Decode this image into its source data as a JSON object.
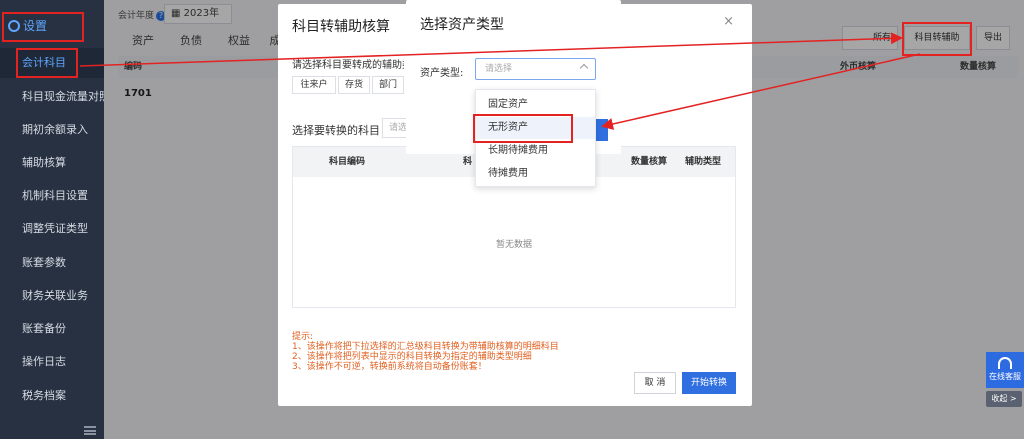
{
  "sidebar": {
    "settings_label": "设置",
    "items": [
      {
        "label": "会计科目"
      },
      {
        "label": "科目现金流量对照"
      },
      {
        "label": "期初余额录入"
      },
      {
        "label": "辅助核算"
      },
      {
        "label": "机制科目设置"
      },
      {
        "label": "调整凭证类型"
      },
      {
        "label": "账套参数"
      },
      {
        "label": "财务关联业务"
      },
      {
        "label": "账套备份"
      },
      {
        "label": "操作日志"
      },
      {
        "label": "税务档案"
      }
    ]
  },
  "main": {
    "fiscal_year_label": "会计年度",
    "fiscal_year_help": "?",
    "fiscal_year_value": "2023年",
    "tabs": [
      {
        "label": "资产"
      },
      {
        "label": "负债"
      },
      {
        "label": "权益"
      },
      {
        "label": "成"
      }
    ],
    "toolbar": {
      "export_all_partial": "所有",
      "convert_aux_label": "科目转辅助",
      "export_label": "导出"
    },
    "table": {
      "col_code": "编码",
      "col_foreign": "外币核算",
      "col_quantity": "数量核算",
      "first_row_code": "1701"
    }
  },
  "dialog_convert": {
    "title": "科目转辅助核算",
    "close": "×",
    "select_aux_prompt": "请选择科目要转成的辅助类",
    "chips": [
      {
        "label": "往来户"
      },
      {
        "label": "存货"
      },
      {
        "label": "部门"
      }
    ],
    "select_account_label": "选择要转换的科目",
    "select_placeholder_partial": "请选",
    "table_headers": {
      "code": "科目编码",
      "name_partial": "科",
      "quantity": "数量核算",
      "aux_type": "辅助类型"
    },
    "empty_text": "暂无数据",
    "tips": {
      "title": "提示:",
      "line1": "1、该操作将把下拉选择的汇总级科目转换为带辅助核算的明细科目",
      "line2": "2、该操作将把列表中显示的科目转换为指定的辅助类型明细",
      "line3": "3、该操作不可逆，转换前系统将自动备份账套！"
    },
    "cancel_label": "取 消",
    "start_label": "开始转换"
  },
  "dialog_asset": {
    "title": "选择资产类型",
    "field_label": "资产类型:",
    "select_placeholder": "请选择",
    "options": [
      {
        "label": "固定资产"
      },
      {
        "label": "无形资产"
      },
      {
        "label": "长期待摊费用"
      },
      {
        "label": "待摊费用"
      }
    ],
    "selected_option": "无形资产"
  },
  "widgets": {
    "customer_service_label": "在线客服",
    "collapse_label": "收起 >"
  },
  "colors": {
    "accent": "#2f6fe0",
    "annotation_red": "#e32222",
    "sidebar_bg": "#273142",
    "tip_orange": "#e06020"
  }
}
